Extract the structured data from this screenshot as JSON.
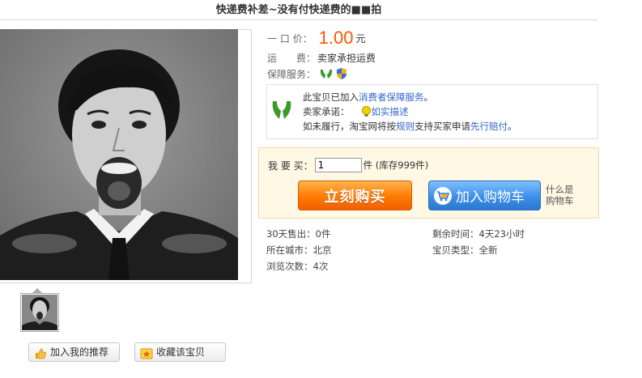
{
  "title": "快递费补差~没有付快递费的■■拍",
  "price": {
    "label": "一 口 价：",
    "value": "1.00",
    "unit": "元"
  },
  "shipping": {
    "label": "运　　费：",
    "value": "卖家承担运费"
  },
  "guarantee_label": "保障服务：",
  "guarantee_box": {
    "line1_prefix": "此宝贝已加入",
    "line1_link": "消费者保障服务",
    "line1_suffix": "。",
    "line2_label": "卖家承诺：",
    "line2_link": "如实描述",
    "line3_prefix": "如未履行，淘宝网将按",
    "line3_link1": "规则",
    "line3_mid": "支持买家申请",
    "line3_link2": "先行赔付",
    "line3_suffix": "。"
  },
  "buy": {
    "qty_label": "我 要 买：",
    "qty_value": "1",
    "stock": "件 (库存999件)",
    "buy_now": "立刻购买",
    "add_cart": "加入购物车",
    "whats_cart_1": "什么是",
    "whats_cart_2": "购物车"
  },
  "stats": {
    "sold": "30天售出：0件",
    "remaining": "剩余时间：4天23小时",
    "city": "所在城市：北京",
    "type": "宝贝类型：全新",
    "views": "浏览次数：4次"
  },
  "actions": {
    "recommend": "加入我的推荐",
    "favorite": "收藏该宝贝"
  },
  "colors": {
    "price": "#ff5500",
    "link": "#3366cc",
    "buy_now": "#ff7a00",
    "add_cart": "#3d8fe6"
  }
}
